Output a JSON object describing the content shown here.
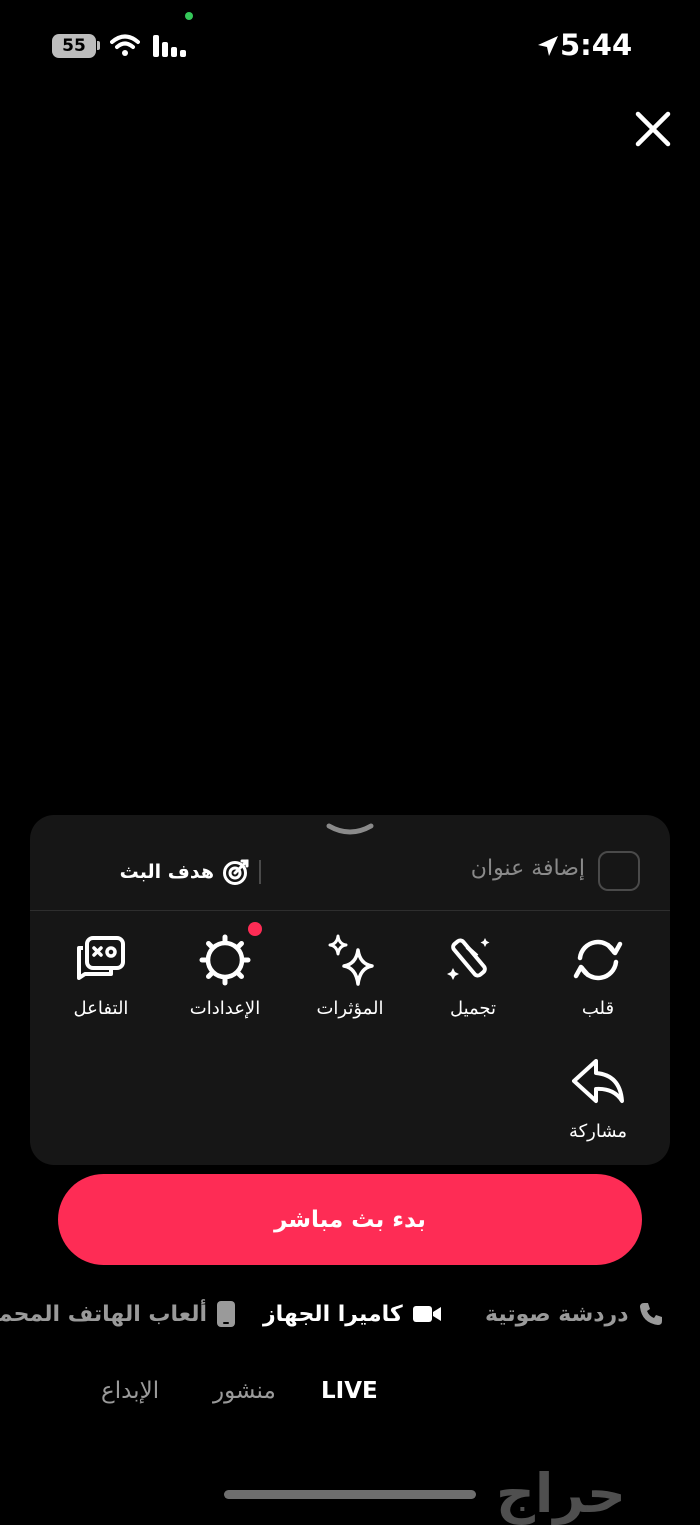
{
  "status_bar": {
    "time": "5:44",
    "battery": "55",
    "icons": [
      "location-arrow-icon",
      "battery-icon",
      "wifi-icon",
      "signal-icon"
    ]
  },
  "header": {
    "close_icon": "close-icon"
  },
  "panel": {
    "title_placeholder": "إضافة عنوان",
    "goal_label": "هدف البث",
    "tools": [
      {
        "label": "قلب",
        "icon": "flip-camera-icon"
      },
      {
        "label": "تجميل",
        "icon": "beauty-wand-icon"
      },
      {
        "label": "المؤثرات",
        "icon": "sparkle-effects-icon"
      },
      {
        "label": "الإعدادات",
        "icon": "settings-gear-icon",
        "has_notification_dot": true
      },
      {
        "label": "التفاعل",
        "icon": "interaction-icon"
      }
    ],
    "share_label": "مشاركة",
    "go_live_label": "بدء بث مباشر"
  },
  "modes": [
    {
      "label": "دردشة صوتية",
      "icon": "phone-icon",
      "selected": false
    },
    {
      "label": "كاميرا الجهاز",
      "icon": "video-camera-icon",
      "selected": true
    },
    {
      "label": "ألعاب الهاتف المحمول",
      "icon": "mobile-phone-icon",
      "selected": false
    }
  ],
  "bottom_tabs": [
    {
      "label": "LIVE",
      "selected": true
    },
    {
      "label": "منشور",
      "selected": false
    },
    {
      "label": "الإبداع",
      "selected": false
    }
  ],
  "watermark": "حراج",
  "colors": {
    "accent": "#fe2c55",
    "background": "#000000",
    "panel": "#161616"
  }
}
